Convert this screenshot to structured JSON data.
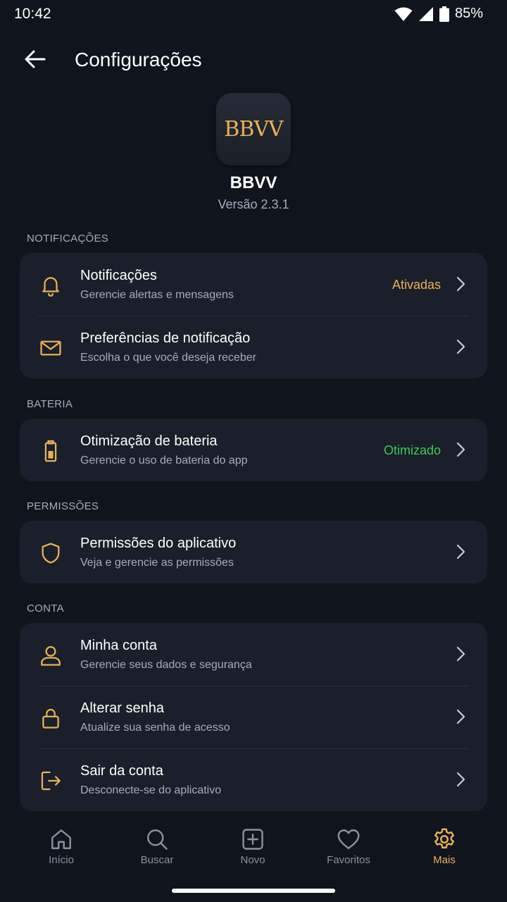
{
  "status_bar": {
    "time": "10:42",
    "battery": "85%"
  },
  "header": {
    "title": "Configurações"
  },
  "app": {
    "logo_text": "BBVV",
    "name": "BBVV",
    "version": "Versão 2.3.1"
  },
  "colors": {
    "accent": "#e7b15c",
    "success": "#3fc85a",
    "background": "#0f141d",
    "card": "#1a1f2a"
  },
  "sections": {
    "notificacoes": {
      "label": "NOTIFICAÇÕES",
      "items": [
        {
          "icon": "bell-icon",
          "title": "Notificações",
          "subtitle": "Gerencie alertas e mensagens",
          "status": "Ativadas"
        },
        {
          "icon": "mail-icon",
          "title": "Preferências de notificação",
          "subtitle": "Escolha o que você deseja receber"
        }
      ]
    },
    "bateria": {
      "label": "BATERIA",
      "items": [
        {
          "icon": "battery-icon",
          "title": "Otimização de bateria",
          "subtitle": "Gerencie o uso de bateria do app",
          "status": "Otimizado"
        }
      ]
    },
    "permissoes": {
      "label": "PERMISSÕES",
      "items": [
        {
          "icon": "shield-icon",
          "title": "Permissões do aplicativo",
          "subtitle": "Veja e gerencie as permissões"
        }
      ]
    },
    "conta": {
      "label": "CONTA",
      "items": [
        {
          "icon": "user-icon",
          "title": "Minha conta",
          "subtitle": "Gerencie seus dados e segurança"
        },
        {
          "icon": "lock-icon",
          "title": "Alterar senha",
          "subtitle": "Atualize sua senha de acesso"
        },
        {
          "icon": "logout-icon",
          "title": "Sair da conta",
          "subtitle": "Desconecte-se do aplicativo"
        }
      ]
    }
  },
  "bottom_nav": [
    {
      "icon": "home-icon",
      "label": "Início"
    },
    {
      "icon": "search-icon",
      "label": "Buscar"
    },
    {
      "icon": "plus-square-icon",
      "label": "Novo"
    },
    {
      "icon": "heart-icon",
      "label": "Favoritos"
    },
    {
      "icon": "gear-icon",
      "label": "Mais",
      "active": true
    }
  ]
}
